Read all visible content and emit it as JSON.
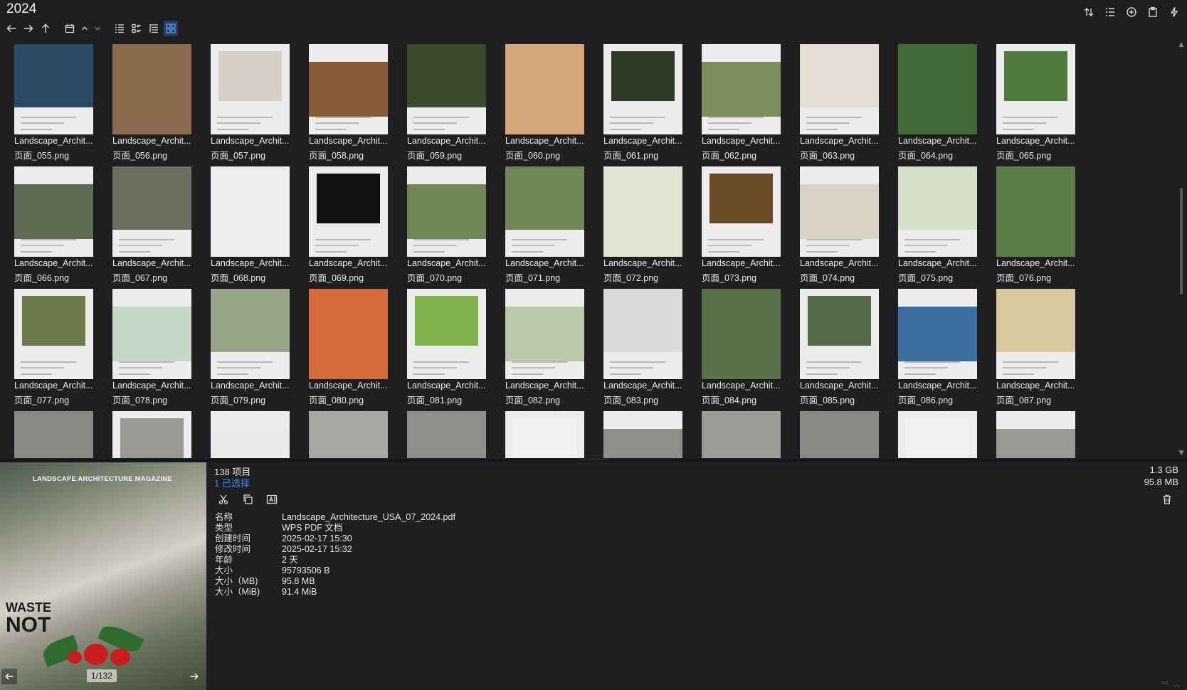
{
  "window": {
    "title": "2024"
  },
  "toolbar": {
    "buttons": [
      "back",
      "forward",
      "up",
      "window",
      "sort-up",
      "sort-down",
      "view-details",
      "view-list",
      "view-tree",
      "view-thumbnails"
    ]
  },
  "right_toolbar": [
    "sort-icon",
    "list-icon",
    "add-icon",
    "clipboard-icon",
    "bolt-icon"
  ],
  "tiles": [
    {
      "name": "Landscape_Archit...",
      "file": "页面_055.png",
      "thumb": "#2b4a66"
    },
    {
      "name": "Landscape_Archit...",
      "file": "页面_056.png",
      "thumb": "#8c6b4f"
    },
    {
      "name": "Landscape_Archit...",
      "file": "页面_057.png",
      "thumb": "#d6d0c6"
    },
    {
      "name": "Landscape_Archit...",
      "file": "页面_058.png",
      "thumb": "#8a5a34"
    },
    {
      "name": "Landscape_Archit...",
      "file": "页面_059.png",
      "thumb": "#3b4a2c"
    },
    {
      "name": "Landscape_Archit...",
      "file": "页面_060.png",
      "thumb": "#d4a679"
    },
    {
      "name": "Landscape_Archit...",
      "file": "页面_061.png",
      "thumb": "#2f3a26"
    },
    {
      "name": "Landscape_Archit...",
      "file": "页面_062.png",
      "thumb": "#7e8d5c"
    },
    {
      "name": "Landscape_Archit...",
      "file": "页面_063.png",
      "thumb": "#e3ddd3"
    },
    {
      "name": "Landscape_Archit...",
      "file": "页面_064.png",
      "thumb": "#3f6a36"
    },
    {
      "name": "Landscape_Archit...",
      "file": "页面_065.png",
      "thumb": "#4f7a3c"
    },
    {
      "name": "Landscape_Archit...",
      "file": "页面_066.png",
      "thumb": "#5e6a52"
    },
    {
      "name": "Landscape_Archit...",
      "file": "页面_067.png",
      "thumb": "#6c6f5f"
    },
    {
      "name": "Landscape_Archit...",
      "file": "页面_068.png",
      "thumb": "#eeeeee"
    },
    {
      "name": "Landscape_Archit...",
      "file": "页面_069.png",
      "thumb": "#111111"
    },
    {
      "name": "Landscape_Archit...",
      "file": "页面_070.png",
      "thumb": "#6e8756"
    },
    {
      "name": "Landscape_Archit...",
      "file": "页面_071.png",
      "thumb": "#6e8756"
    },
    {
      "name": "Landscape_Archit...",
      "file": "页面_072.png",
      "thumb": "#e0e5d2"
    },
    {
      "name": "Landscape_Archit...",
      "file": "页面_073.png",
      "thumb": "#6b4a28"
    },
    {
      "name": "Landscape_Archit...",
      "file": "页面_074.png",
      "thumb": "#d8d2c4"
    },
    {
      "name": "Landscape_Archit...",
      "file": "页面_075.png",
      "thumb": "#d6e0c8"
    },
    {
      "name": "Landscape_Archit...",
      "file": "页面_076.png",
      "thumb": "#5d7d48"
    },
    {
      "name": "Landscape_Archit...",
      "file": "页面_077.png",
      "thumb": "#6b7a48"
    },
    {
      "name": "Landscape_Archit...",
      "file": "页面_078.png",
      "thumb": "#c8d8c8"
    },
    {
      "name": "Landscape_Archit...",
      "file": "页面_079.png",
      "thumb": "#9aa68a"
    },
    {
      "name": "Landscape_Archit...",
      "file": "页面_080.png",
      "thumb": "#d66a3a"
    },
    {
      "name": "Landscape_Archit...",
      "file": "页面_081.png",
      "thumb": "#7fb24a"
    },
    {
      "name": "Landscape_Archit...",
      "file": "页面_082.png",
      "thumb": "#b8c8a8"
    },
    {
      "name": "Landscape_Archit...",
      "file": "页面_083.png",
      "thumb": "#dadada"
    },
    {
      "name": "Landscape_Archit...",
      "file": "页面_084.png",
      "thumb": "#5a6f4a"
    },
    {
      "name": "Landscape_Archit...",
      "file": "页面_085.png",
      "thumb": "#556a48"
    },
    {
      "name": "Landscape_Archit...",
      "file": "页面_086.png",
      "thumb": "#3a6fa0"
    },
    {
      "name": "Landscape_Archit...",
      "file": "页面_087.png",
      "thumb": "#d7c8a0"
    },
    {
      "name": "",
      "file": "",
      "thumb": "#8a8a84"
    },
    {
      "name": "",
      "file": "",
      "thumb": "#9a9a94"
    },
    {
      "name": "",
      "file": "",
      "thumb": "#eaeaea"
    },
    {
      "name": "",
      "file": "",
      "thumb": "#a8a8a2"
    },
    {
      "name": "",
      "file": "",
      "thumb": "#8e8e8a"
    },
    {
      "name": "",
      "file": "",
      "thumb": "#f0f0f0"
    },
    {
      "name": "",
      "file": "",
      "thumb": "#8e8e8a"
    },
    {
      "name": "",
      "file": "",
      "thumb": "#9c9c96"
    },
    {
      "name": "",
      "file": "",
      "thumb": "#8a8a84"
    },
    {
      "name": "",
      "file": "",
      "thumb": "#f0f0f0"
    },
    {
      "name": "",
      "file": "",
      "thumb": "#9a9a94"
    }
  ],
  "preview": {
    "magazine": "LANDSCAPE ARCHITECTURE MAGAZINE",
    "headline_1": "WASTE",
    "headline_2": "NOT",
    "page_indicator": "1/132"
  },
  "status": {
    "item_count": "138 项目",
    "selected": "1 已选择",
    "total_size": "1.3 GB",
    "selected_size": "95.8 MB"
  },
  "properties": [
    {
      "key": "名称",
      "value": "Landscape_Architecture_USA_07_2024.pdf"
    },
    {
      "key": "类型",
      "value": "WPS PDF 文档"
    },
    {
      "key": "创建时间",
      "value": "2025-02-17  15:30"
    },
    {
      "key": "修改时间",
      "value": "2025-02-17  15:32"
    },
    {
      "key": "年龄",
      "value": "2 天"
    },
    {
      "key": "大小",
      "value": "95793506 B"
    },
    {
      "key": "大小（MB)",
      "value": "95.8 MB"
    },
    {
      "key": "大小（MiB)",
      "value": "91.4 MiB"
    }
  ]
}
